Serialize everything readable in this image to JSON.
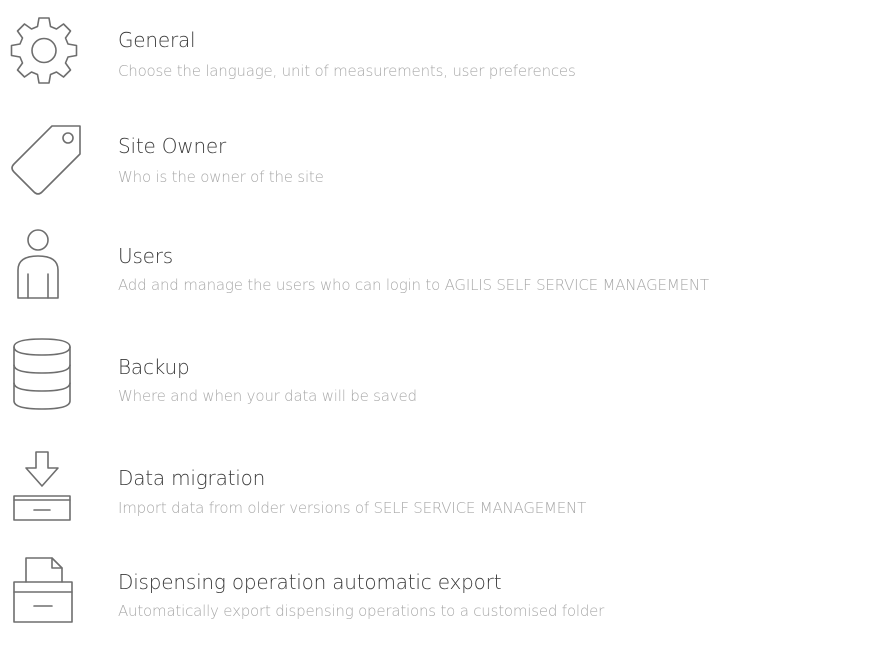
{
  "settings": {
    "items": [
      {
        "icon": "gear-icon",
        "title": "General",
        "description": "Choose the language, unit of measurements, user preferences"
      },
      {
        "icon": "tag-icon",
        "title": "Site Owner",
        "description": "Who is the owner of the site"
      },
      {
        "icon": "user-icon",
        "title": "Users",
        "description": "Add and manage the users who can login to AGILIS SELF SERVICE MANAGEMENT"
      },
      {
        "icon": "database-icon",
        "title": "Backup",
        "description": "Where and when your data will be saved"
      },
      {
        "icon": "import-tray-icon",
        "title": "Data migration",
        "description": "Import data from older versions of SELF SERVICE MANAGEMENT"
      },
      {
        "icon": "export-tray-icon",
        "title": "Dispensing operation automatic export",
        "description": "Automatically export dispensing operations to a customised folder"
      }
    ]
  },
  "colors": {
    "title_text": "#3a3a3a",
    "description_text": "#a8a8a8",
    "icon_stroke": "#6e6e6e",
    "background": "#ffffff"
  }
}
